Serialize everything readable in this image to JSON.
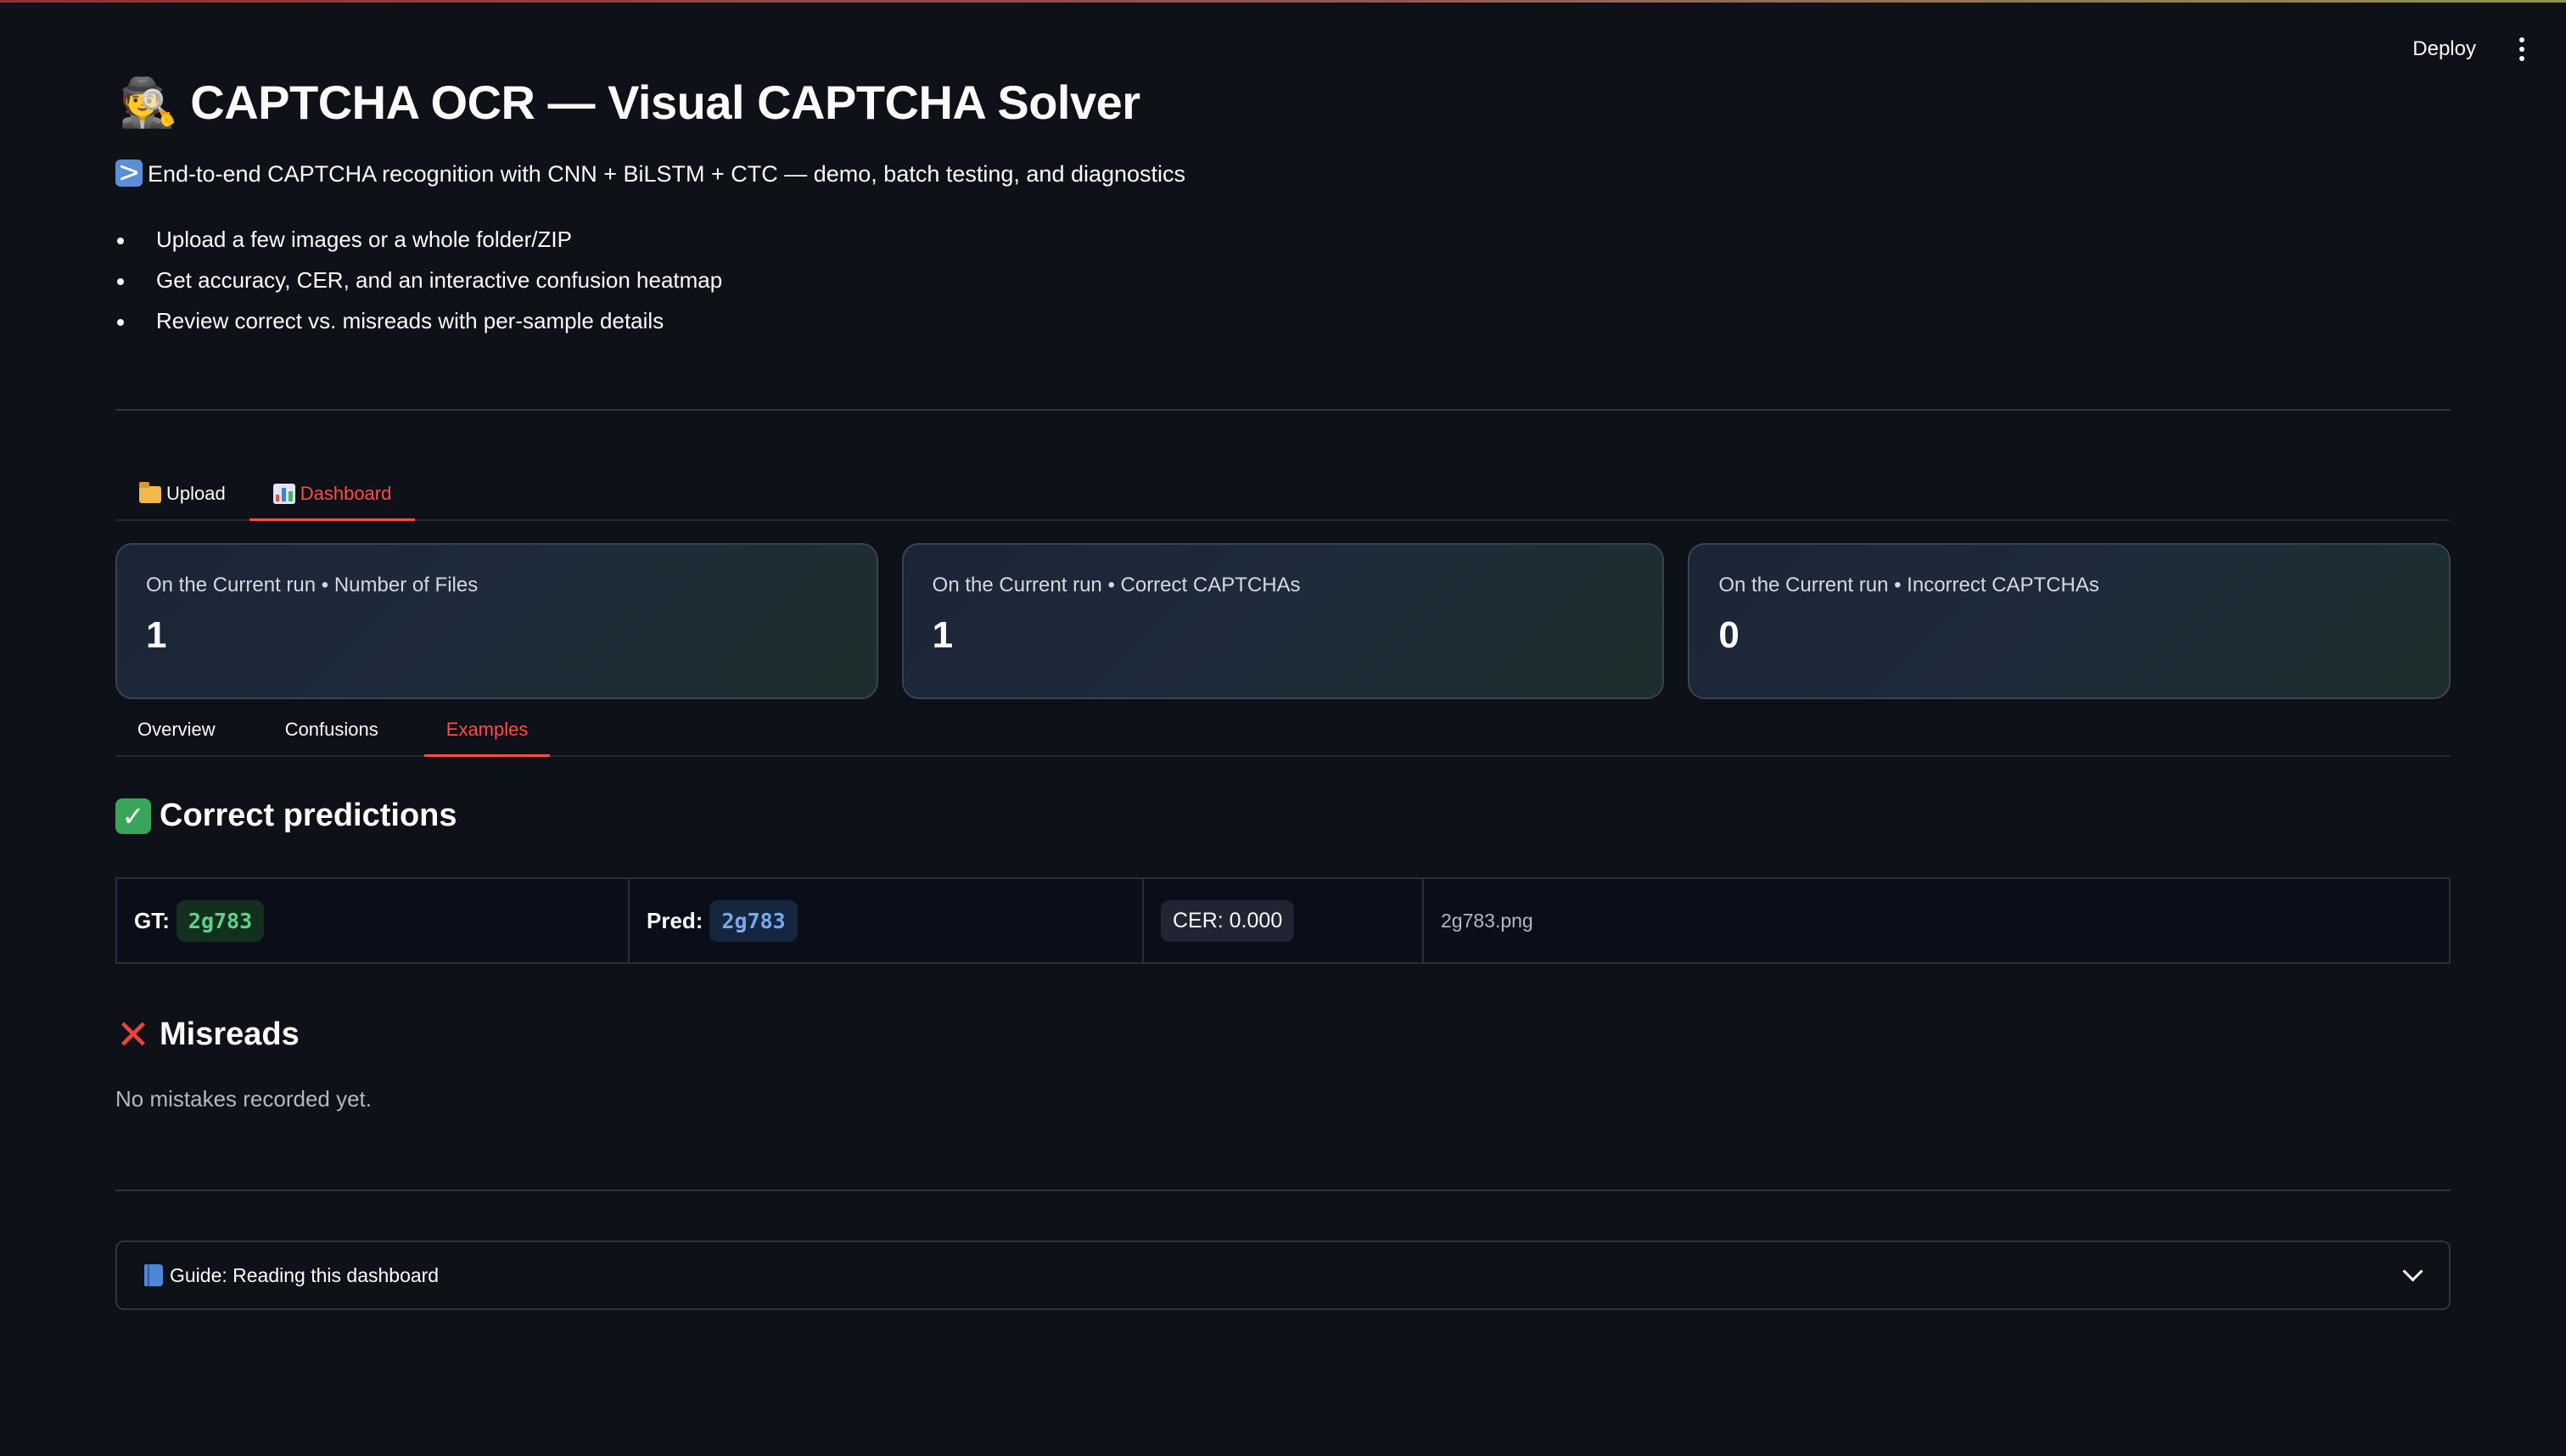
{
  "header": {
    "deploy_label": "Deploy"
  },
  "hero": {
    "title": "🕵️ CAPTCHA OCR — Visual CAPTCHA Solver",
    "subtitle": "End-to-end CAPTCHA recognition with CNN + BiLSTM + CTC — demo, batch testing, and diagnostics",
    "bullets": [
      "Upload a few images or a whole folder/ZIP",
      "Get accuracy, CER, and an interactive confusion heatmap",
      "Review correct vs. misreads with per-sample details"
    ]
  },
  "main_tabs": [
    {
      "label": "Upload",
      "icon": "folder-icon",
      "active": false
    },
    {
      "label": "Dashboard",
      "icon": "bar-chart-icon",
      "active": true
    }
  ],
  "metrics": [
    {
      "label": "On the Current run • Number of Files",
      "value": "1"
    },
    {
      "label": "On the Current run • Correct CAPTCHAs",
      "value": "1"
    },
    {
      "label": "On the Current run • Incorrect CAPTCHAs",
      "value": "0"
    }
  ],
  "sub_tabs": [
    {
      "label": "Overview",
      "active": false
    },
    {
      "label": "Confusions",
      "active": false
    },
    {
      "label": "Examples",
      "active": true
    }
  ],
  "correct_section": {
    "title": "Correct predictions",
    "rows": [
      {
        "gt_label": "GT:",
        "gt": "2g783",
        "pred_label": "Pred:",
        "pred": "2g783",
        "cer": "CER: 0.000",
        "file": "2g783.png"
      }
    ]
  },
  "misreads_section": {
    "title": "Misreads",
    "empty_text": "No mistakes recorded yet."
  },
  "guide": {
    "label": "Guide: Reading this dashboard"
  },
  "colors": {
    "accent": "#ff4b4b",
    "background": "#0e1117",
    "gt_chip": "#5fd38a",
    "pred_chip": "#76a9f0"
  }
}
